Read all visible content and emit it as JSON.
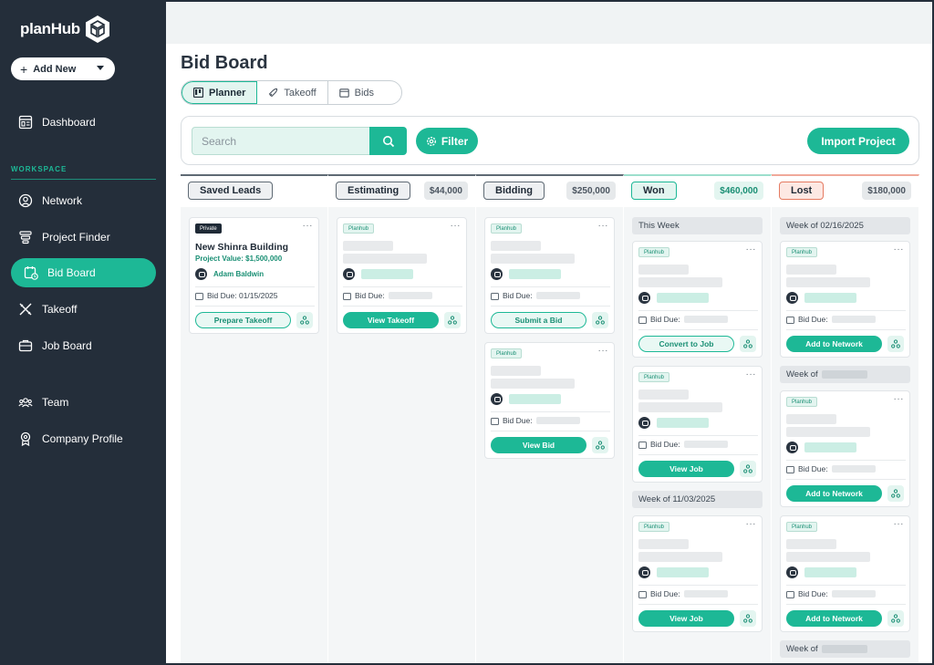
{
  "app": {
    "name": "planHub"
  },
  "sidebar": {
    "add_new": "Add New",
    "section_label": "WORKSPACE",
    "items": [
      {
        "label": "Dashboard",
        "icon": "dashboard-icon"
      },
      {
        "label": "Network",
        "icon": "network-icon"
      },
      {
        "label": "Project Finder",
        "icon": "project-finder-icon"
      },
      {
        "label": "Bid Board",
        "icon": "bid-board-icon",
        "active": true
      },
      {
        "label": "Takeoff",
        "icon": "takeoff-icon"
      },
      {
        "label": "Job Board",
        "icon": "job-board-icon"
      },
      {
        "label": "Team",
        "icon": "team-icon"
      },
      {
        "label": "Company Profile",
        "icon": "company-profile-icon"
      }
    ]
  },
  "header": {
    "title": "Bid Board"
  },
  "tabs": [
    {
      "label": "Planner",
      "active": true
    },
    {
      "label": "Takeoff"
    },
    {
      "label": "Bids"
    }
  ],
  "toolbar": {
    "search_placeholder": "Search",
    "filter_label": "Filter",
    "import_label": "Import Project"
  },
  "columns": [
    {
      "name": "Saved Leads",
      "amount": ""
    },
    {
      "name": "Estimating",
      "amount": "$44,000"
    },
    {
      "name": "Bidding",
      "amount": "$250,000"
    },
    {
      "name": "Won",
      "amount": "$460,000"
    },
    {
      "name": "Lost",
      "amount": "$180,000"
    }
  ],
  "cards": {
    "saved": {
      "tag": "Private",
      "title": "New Shinra Building",
      "value": "Project Value: $1,500,000",
      "owner": "Adam Baldwin",
      "due": "Bid Due: 01/15/2025",
      "action": "Prepare Takeoff"
    },
    "tag_planhub": "Planhub",
    "bid_due": "Bid Due:",
    "estimating_action": "View Takeoff",
    "bidding_actions": [
      "Submit a Bid",
      "View Bid"
    ],
    "won_actions": [
      "Convert to Job",
      "View Job",
      "View Job"
    ],
    "lost_action": "Add to Network"
  },
  "weeks": {
    "won": [
      "This Week",
      "Week of 11/03/2025"
    ],
    "lost": [
      "Week of 02/16/2025",
      "Week of",
      "Week of"
    ]
  },
  "colors": {
    "accent": "#1db896",
    "sidebar": "#242e3a",
    "lost": "#e57b62"
  }
}
